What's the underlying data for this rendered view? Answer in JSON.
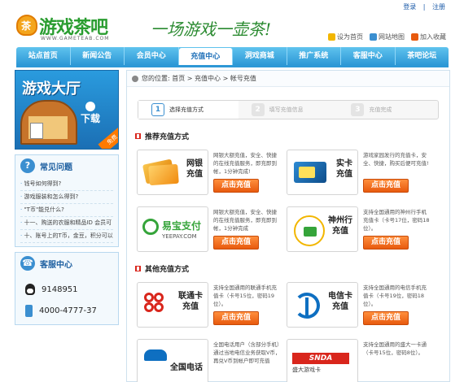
{
  "header": {
    "login": "登录",
    "divider": "|",
    "register": "注册",
    "logo_text": "游戏茶吧",
    "logo_url": "WWW.GAMETEAB.COM",
    "slogan": "一场游戏一壶茶!",
    "set_home": "设为首页",
    "site_map": "网站地图",
    "favorite": "加入收藏"
  },
  "nav": {
    "items": [
      "站点首页",
      "新闻公告",
      "会员中心",
      "充值中心",
      "洞戏商城",
      "推广系统",
      "客服中心",
      "茶吧论坛"
    ],
    "active_index": 3
  },
  "sidebar": {
    "banner_title": "游戏大厅",
    "banner_download": "下载",
    "banner_badge": "免费",
    "faq_title": "常见问题",
    "faq_items": [
      "钱号如何得到?",
      "游戏服装和怎么得到?",
      "\"T币\"能兑什么?",
      "十一、购送的农服和精品ID 会员可",
      "十、账号上的T币，金豆，积分可以"
    ],
    "cs_title": "客服中心",
    "qq": "9148951",
    "phone": "4000-4777-37"
  },
  "main": {
    "breadcrumb": "您的位置: 首页 > 充值中心 > 帐号充值",
    "steps": [
      {
        "num": "1",
        "label": "选择充值方式"
      },
      {
        "num": "2",
        "label": "填写充值信息"
      },
      {
        "num": "3",
        "label": "充值完成"
      }
    ],
    "recommended_title": "推荐充值方式",
    "other_title": "其他充值方式",
    "pay_button": "点击充值",
    "recommended": [
      {
        "name_l1": "网银",
        "name_l2": "充值",
        "desc": "网银大额充值，安全、快捷的在线充值服务，即充即到帐，1分钟完成!"
      },
      {
        "name_l1": "实卡",
        "name_l2": "充值",
        "desc": "游戏家园发行的充值卡，安全、快捷，购买后便可充值!"
      },
      {
        "name_l1": "易宝支付",
        "name_l2": "YEEPAY.COM",
        "desc": "网银大额充值，安全、快捷的在线充值服务，即充即到帐，1分钟完成"
      },
      {
        "name_l1": "神州行",
        "name_l2": "充值",
        "desc": "支持全国通用的神州行手机充值卡（卡号17位，密码18位）。"
      }
    ],
    "other": [
      {
        "name_l1": "联通卡",
        "name_l2": "充值",
        "desc": "支持全国通用的联通手机充值卡（卡号15位，密码19位）。"
      },
      {
        "name_l1": "电信卡",
        "name_l2": "充值",
        "desc": "支持全国通用的电信手机充值卡（卡号19位，密码18位）。"
      },
      {
        "name_l1": "全国电话",
        "name_l2": "",
        "desc": "全国电话用户（含部分手机）通过当地电信业务获取V币，再兑V币到帐户即可充值"
      },
      {
        "name_l1": "SNDA",
        "name_l2": "盛大游戏卡",
        "desc": "支持全国通用的盛大一卡通（卡号15位，密码8位）。"
      }
    ]
  },
  "colors": {
    "nav_blue": "#2d98d6",
    "accent_orange": "#e85a0e",
    "brand_green": "#2a9d30"
  }
}
